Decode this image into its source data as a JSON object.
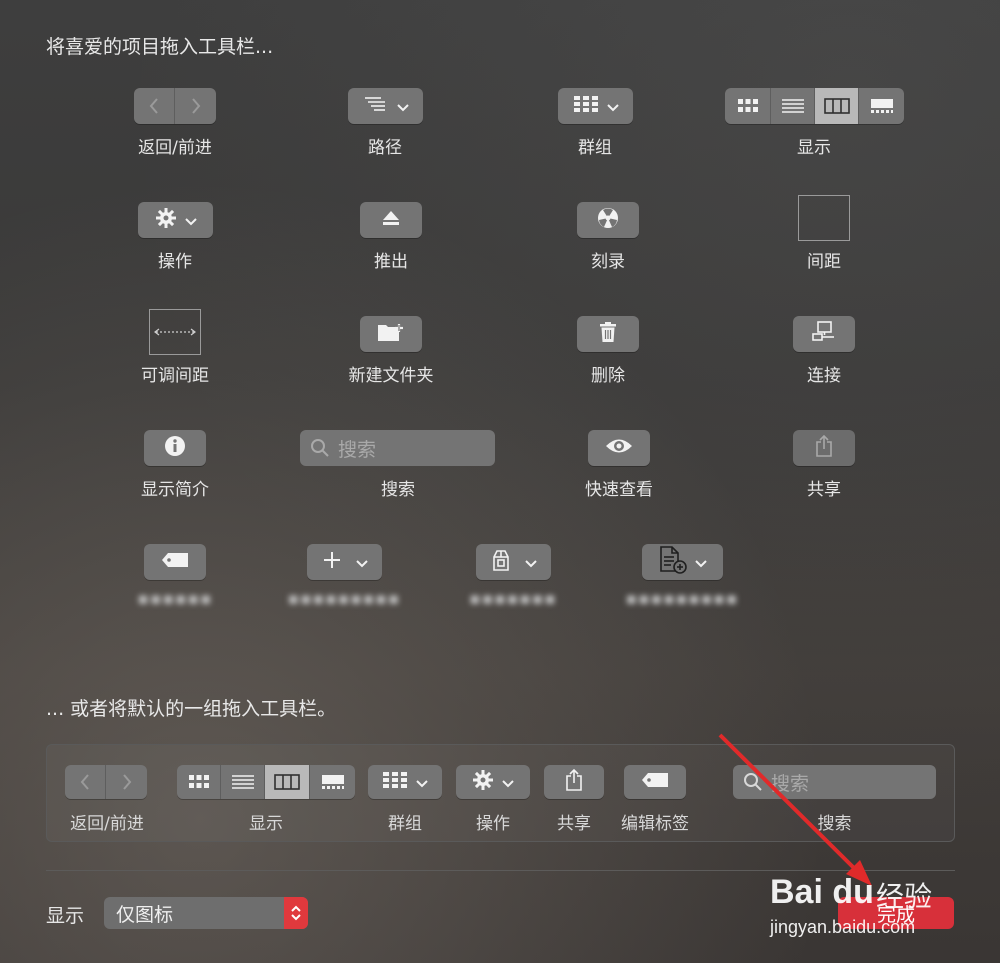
{
  "drag_items_heading": "将喜爱的项目拖入工具栏...",
  "default_set_heading": "... 或者将默认的一组拖入工具栏。",
  "items": {
    "back_forward": "返回/前进",
    "path": "路径",
    "group": "群组",
    "view": "显示",
    "action": "操作",
    "eject": "推出",
    "burn": "刻录",
    "space": "间距",
    "flexible_space": "可调间距",
    "new_folder": "新建文件夹",
    "delete": "删除",
    "connect": "连接",
    "get_info": "显示简介",
    "search": "搜索",
    "search_placeholder": "搜索",
    "quick_look": "快速查看",
    "share": "共享",
    "blurred_1": "▪▪▪▪▪▪",
    "blurred_2": "▪▪▪▪▪▪▪▪▪",
    "blurred_3": "▪▪▪▪▪▪▪",
    "blurred_4": "▪▪▪▪▪▪▪▪▪"
  },
  "default_toolbar": {
    "back_forward": "返回/前进",
    "view": "显示",
    "group": "群组",
    "action": "操作",
    "share": "共享",
    "edit_tags": "编辑标签",
    "search": "搜索",
    "search_placeholder": "搜索"
  },
  "footer": {
    "show_label": "显示",
    "show_value": "仅图标",
    "done_button": "完成"
  },
  "watermark": {
    "brand": "Bai du",
    "brand_cn": "经验",
    "url": "jingyan.baidu.com"
  },
  "colors": {
    "accent_red": "#d7303a",
    "button_gray": "#747474"
  }
}
